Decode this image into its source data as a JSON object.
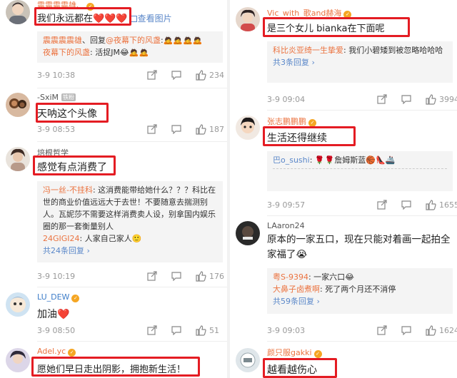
{
  "left_comments": [
    {
      "username": "震震震震雄、",
      "text": "我们永远都在❤️❤️❤️",
      "trail": "查看图片",
      "reply_line1_user": "震震震震雄",
      "reply_line1_text": "、回复",
      "reply_line1_target": "@夜幕下的风盏",
      "reply_line1_emoji": ":🙇🙇🙇🙇",
      "reply_line2_user": "夜幕下的风盏",
      "reply_line2_text": ": 活捉JM😂🙇🙇",
      "time": "3-9 10:38",
      "likes": "234"
    },
    {
      "username": "-SxiM",
      "badge": "铁粉",
      "text": "天呐这个头像",
      "time": "3-9 08:53",
      "likes": "187"
    },
    {
      "username": "培根哲学",
      "text": "感觉有点消费了",
      "reply_user": "冯一丝-不挂科",
      "reply_text": ": 这消费能带给她什么？？？科比在世的商业价值远远大于去世！不要随意去揣测别人。瓦妮莎不需要这样消费卖人设，别拿国内娱乐圈的那一套衡量别人",
      "reply2_user": "24GIGI24",
      "reply2_text": ": 人家自己家人🙂",
      "reply_more": "共24条回复",
      "time": "3-9 10:19",
      "likes": "176"
    },
    {
      "username": "LU_DEW",
      "text": "加油❤️",
      "time": "3-9 08:50",
      "likes": "51"
    },
    {
      "username": "Adel.yc",
      "text": "愿她们早日走出阴影，拥抱新生活！"
    }
  ],
  "right_comments": [
    {
      "username": "Vic_with_歌and赫海",
      "text": "是三个女儿 bianka在下面呢",
      "reply_user": "科比炎亚绮一生挚爱",
      "reply_text": ": 我们小碧矮到被忽略哈哈哈",
      "reply_more": "共3条回复",
      "time": "3-9 09:04",
      "likes": "3994"
    },
    {
      "username": "张志鹏鹏鹏",
      "text": "生活还得继续",
      "reply_user": "巴o_sushi",
      "reply_text": ": 🌹🌹詹姆斯蓝🏀👠🚢",
      "time": "3-9 09:57",
      "likes": "1655"
    },
    {
      "username": "LAaron24",
      "text": "原本的一家五口，现在只能对着画一起拍全家福了😭",
      "reply_user": "粤S-9394",
      "reply_text": ": 一家六口😂",
      "reply2_user": "大鼻子卤煮啊",
      "reply2_text": ": 死了两个月还不消停",
      "reply_more": "共59条回复",
      "time": "3-9 09:03",
      "likes": "1624"
    },
    {
      "username": "颜只服gakki",
      "text": "越看越伤心"
    }
  ],
  "colors": {
    "highlight_red": "#e41c23",
    "username_orange": "#eb7340",
    "link_blue": "#5a87c9",
    "meta_gray": "#999999",
    "reply_bg": "#f4f4f4"
  },
  "icons": [
    "share-icon",
    "comment-icon",
    "like-icon",
    "vip-badge-icon",
    "image-icon"
  ]
}
